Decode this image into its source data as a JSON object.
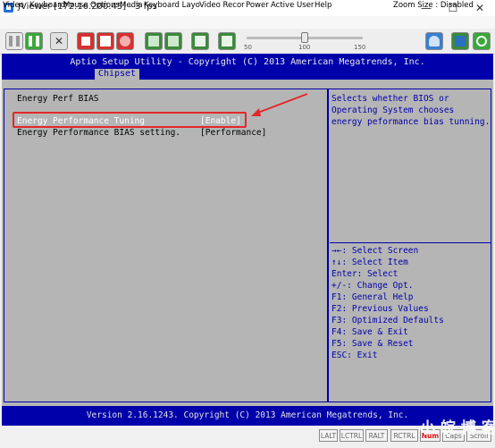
{
  "window": {
    "title": "JViewer [172.16.200.45] - 3 fps",
    "minimize": "—",
    "maximize": "☐",
    "close": "✕"
  },
  "menu": {
    "items": [
      "Video",
      "Keyboard",
      "Mouse",
      "Options",
      "Media",
      "Keyboard Layo",
      "Video Recor",
      "Power",
      "Active User",
      "Help"
    ],
    "zoom": "Zoom Size : Disabled"
  },
  "toolbar": {
    "buttons": [
      "pause-icon",
      "play-icon",
      "fullscreen-icon",
      "stop-icon",
      "save-icon",
      "record-icon",
      "keyboard-icon",
      "virtual-keyboard-icon",
      "terminal-icon",
      "macro-icon",
      "user-icon",
      "display-icon",
      "power-icon"
    ],
    "slider_ticks": [
      "50",
      "100",
      "150"
    ],
    "slider_value": 100
  },
  "bios": {
    "title": "Aptio Setup Utility - Copyright (C) 2013 American Megatrends, Inc.",
    "tab": "Chipset",
    "section_title": "Energy Perf BIAS",
    "items": [
      {
        "label": "Energy Performance Tuning",
        "value": "[Enable]"
      },
      {
        "label": "Energy Performance BIAS setting.",
        "value": "[Performance]"
      }
    ],
    "help_text": [
      "Selects whether BIOS or",
      "Operating System chooses",
      "energy peformance bias tunning."
    ],
    "key_hints": [
      "→←: Select Screen",
      "↑↓: Select Item",
      "Enter: Select",
      "+/-: Change Opt.",
      "F1: General Help",
      "F2: Previous Values",
      "F3: Optimized Defaults",
      "F4: Save & Exit",
      "F5: Save & Reset",
      "ESC: Exit"
    ],
    "footer": "Version 2.16.1243. Copyright (C) 2013 American Megatrends, Inc."
  },
  "status": {
    "keys": [
      "LALT",
      "LCTRL",
      "RALT",
      "RCTRL",
      "Num",
      "Caps",
      "Scroll"
    ],
    "active_key": "Num"
  },
  "watermark": "小 皖 博 客",
  "colors": {
    "bios_blue": "#0000aa",
    "bios_gray": "#b5b5b5",
    "annotation_red": "#e3282a"
  }
}
